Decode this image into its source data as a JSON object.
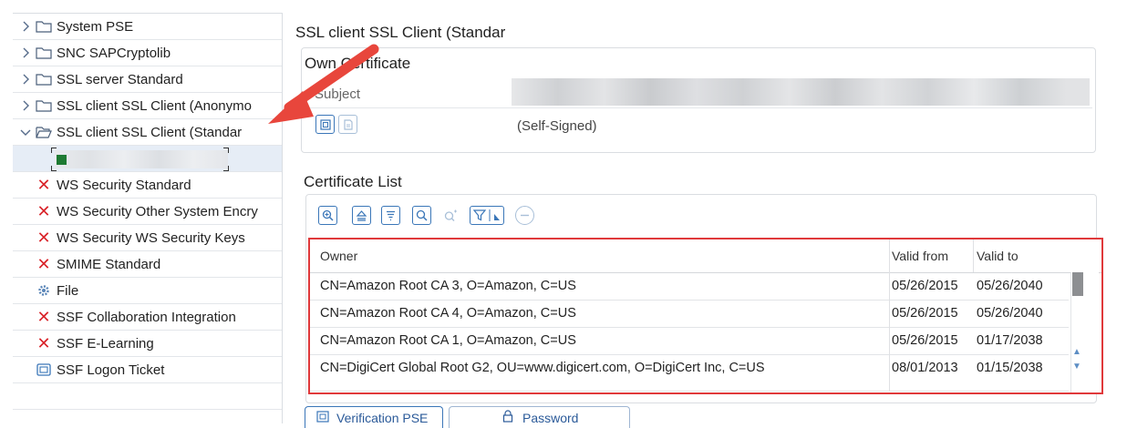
{
  "tree": {
    "items": [
      {
        "label": "System PSE",
        "type": "folder"
      },
      {
        "label": "SNC SAPCryptolib",
        "type": "folder"
      },
      {
        "label": "SSL server Standard",
        "type": "folder"
      },
      {
        "label": "SSL client SSL Client (Anonymo",
        "type": "folder"
      },
      {
        "label": "SSL client SSL Client (Standar",
        "type": "folder-open"
      },
      {
        "label": "",
        "type": "selected-blurred"
      },
      {
        "label": "WS Security Standard",
        "type": "error"
      },
      {
        "label": "WS Security Other System Encry",
        "type": "error"
      },
      {
        "label": "WS Security WS Security Keys",
        "type": "error"
      },
      {
        "label": "SMIME Standard",
        "type": "error"
      },
      {
        "label": "File",
        "type": "gear"
      },
      {
        "label": "SSF Collaboration Integration",
        "type": "error"
      },
      {
        "label": "SSF E-Learning",
        "type": "error"
      },
      {
        "label": "SSF Logon Ticket",
        "type": "ticket"
      }
    ]
  },
  "detail": {
    "title": "SSL client SSL Client (Standar",
    "own_certificate": {
      "title": "Own Certificate",
      "subject_label": "Subject",
      "self_signed": "(Self-Signed)"
    },
    "certificate_list": {
      "title": "Certificate List",
      "columns": [
        "Owner",
        "Valid from",
        "Valid to"
      ],
      "rows": [
        {
          "owner": "CN=Amazon Root CA 3, O=Amazon, C=US",
          "valid_from": "05/26/2015",
          "valid_to": "05/26/2040"
        },
        {
          "owner": "CN=Amazon Root CA 4, O=Amazon, C=US",
          "valid_from": "05/26/2015",
          "valid_to": "05/26/2040"
        },
        {
          "owner": "CN=Amazon Root CA 1, O=Amazon, C=US",
          "valid_from": "05/26/2015",
          "valid_to": "01/17/2038"
        },
        {
          "owner": "CN=DigiCert Global Root G2, OU=www.digicert.com, O=DigiCert Inc, C=US",
          "valid_from": "08/01/2013",
          "valid_to": "01/15/2038"
        }
      ]
    },
    "tabs": [
      "Verification PSE",
      "Password"
    ]
  },
  "colors": {
    "annotation_red": "#e0393b",
    "error_red": "#d9242a",
    "link_blue": "#3a76b8"
  }
}
